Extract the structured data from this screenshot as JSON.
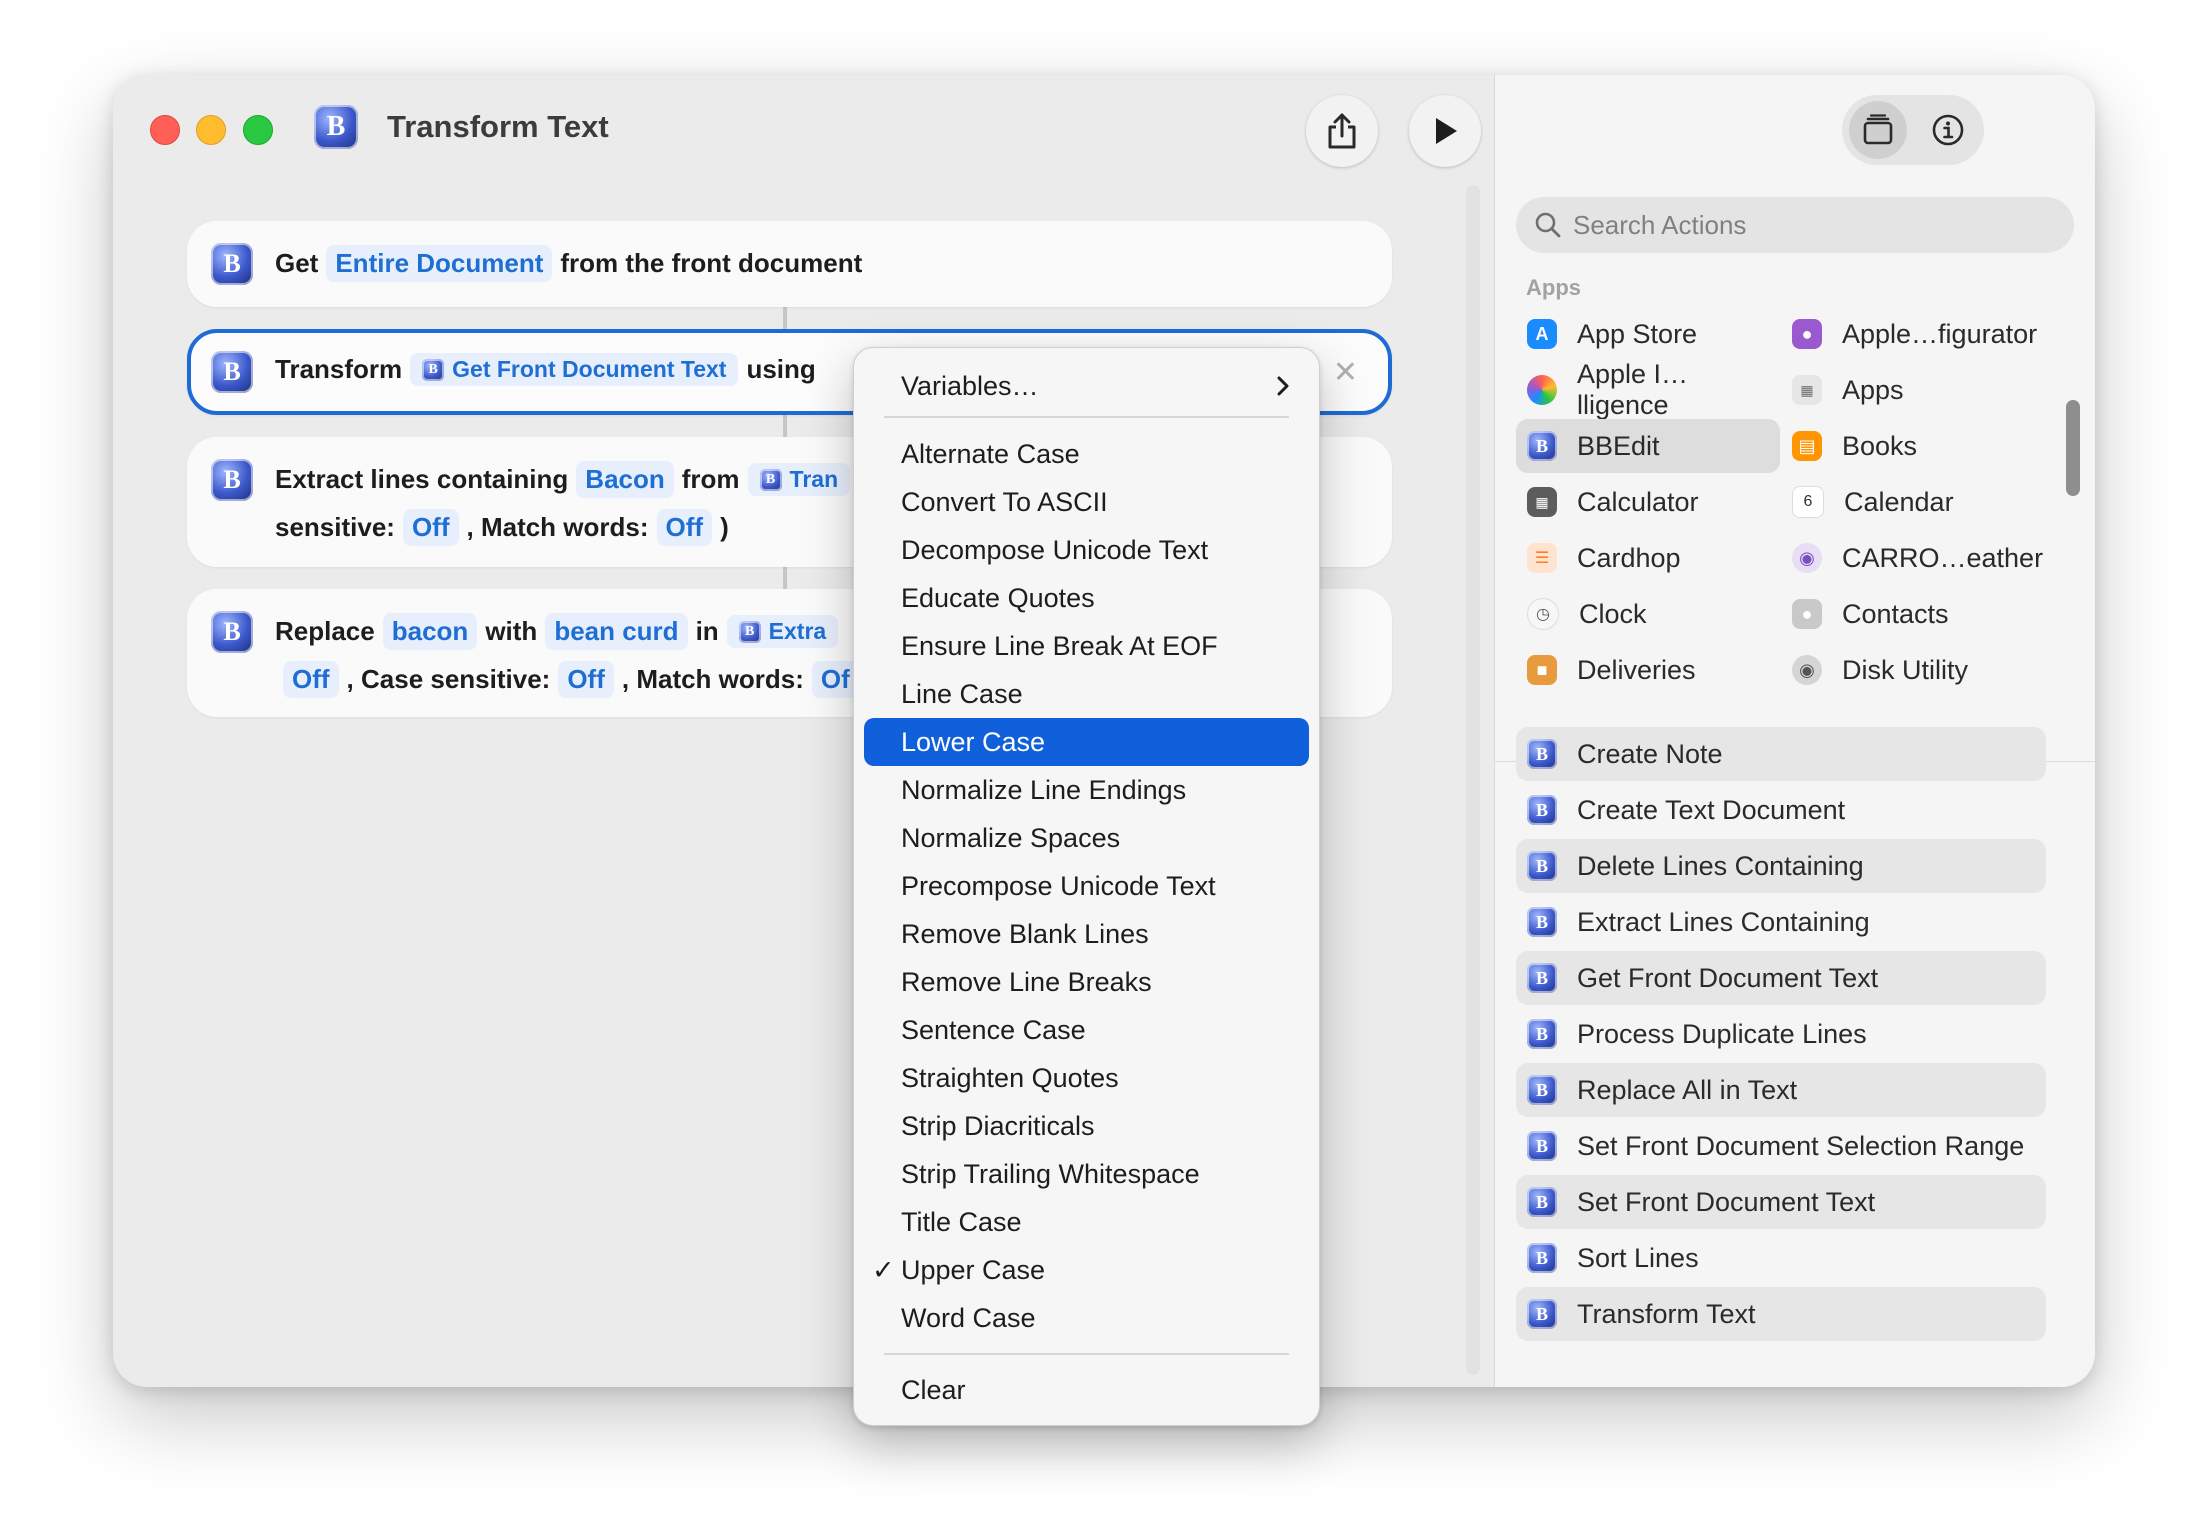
{
  "window": {
    "title": "Transform Text"
  },
  "toolbar": {
    "share_icon": "share-icon",
    "run_icon": "play-icon",
    "library_icon": "library-icon",
    "info_icon": "info-icon"
  },
  "actions": [
    {
      "prefix": "Get",
      "param": "Entire Document",
      "suffix": "from the front document"
    },
    {
      "prefix": "Transform",
      "variable": "Get Front Document Text",
      "suffix": "using"
    },
    {
      "prefix": "Extract lines containing",
      "param": "Bacon",
      "mid": "from",
      "variable": "Tran",
      "line2_label": "sensitive:",
      "line2_val1": "Off",
      "line2_mid": ", Match words:",
      "line2_val2": "Off",
      "line2_end": ")"
    },
    {
      "prefix": "Replace",
      "param": "bacon",
      "mid": "with",
      "param2": "bean curd",
      "mid2": "in",
      "variable": "Extra",
      "line2_val0": "Off",
      "line2_label": ", Case sensitive:",
      "line2_val1": "Off",
      "line2_mid": ", Match words:",
      "line2_val2": "Of"
    }
  ],
  "menu": {
    "variables": "Variables…",
    "items": [
      "Alternate Case",
      "Convert To ASCII",
      "Decompose Unicode Text",
      "Educate Quotes",
      "Ensure Line Break At EOF",
      "Line Case",
      "Lower Case",
      "Normalize Line Endings",
      "Normalize Spaces",
      "Precompose Unicode Text",
      "Remove Blank Lines",
      "Remove Line Breaks",
      "Sentence Case",
      "Straighten Quotes",
      "Strip Diacriticals",
      "Strip Trailing Whitespace",
      "Title Case",
      "Upper Case",
      "Word Case"
    ],
    "highlighted": "Lower Case",
    "checked": "Upper Case",
    "clear": "Clear"
  },
  "sidebar": {
    "search_placeholder": "Search Actions",
    "apps_header": "Apps",
    "apps": [
      {
        "label": "App Store",
        "color": "#1a8cff"
      },
      {
        "label": "Apple…figurator",
        "color": "#9b59d0"
      },
      {
        "label": "Apple I…lligence",
        "color": "#ff7a59"
      },
      {
        "label": "Apps",
        "color": "#8e8e93"
      },
      {
        "label": "BBEdit",
        "color": "#3b58c9"
      },
      {
        "label": "Books",
        "color": "#ff9500"
      },
      {
        "label": "Calculator",
        "color": "#5c5c5c"
      },
      {
        "label": "Calendar",
        "color": "#ffffff"
      },
      {
        "label": "Cardhop",
        "color": "#ff9c40"
      },
      {
        "label": "CARRO…eather",
        "color": "#7a4fbf"
      },
      {
        "label": "Clock",
        "color": "#f2f2f2"
      },
      {
        "label": "Contacts",
        "color": "#a9a9a9"
      },
      {
        "label": "Deliveries",
        "color": "#e89b3c"
      },
      {
        "label": "Disk Utility",
        "color": "#9a9a9a"
      }
    ],
    "calendar_day": "6",
    "actions": [
      "Create Note",
      "Create Text Document",
      "Delete Lines Containing",
      "Extract Lines Containing",
      "Get Front Document Text",
      "Process Duplicate Lines",
      "Replace All in Text",
      "Set Front Document Selection Range",
      "Set Front Document Text",
      "Sort Lines",
      "Transform Text"
    ]
  }
}
